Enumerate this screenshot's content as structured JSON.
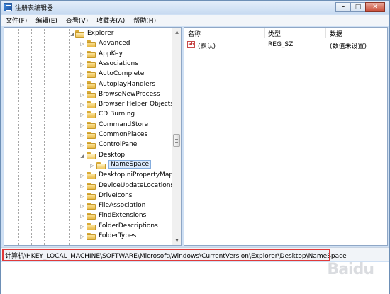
{
  "window": {
    "title": "注册表编辑器",
    "caption_minimize": "–",
    "caption_maximize": "□",
    "caption_close": "✕"
  },
  "menu": [
    "文件(F)",
    "编辑(E)",
    "查看(V)",
    "收藏夹(A)",
    "帮助(H)"
  ],
  "tree": [
    {
      "label": "Explorer",
      "expander": "◢",
      "open": true
    },
    {
      "label": "Advanced",
      "expander": "▷"
    },
    {
      "label": "AppKey",
      "expander": "▷"
    },
    {
      "label": "Associations",
      "expander": "▷"
    },
    {
      "label": "AutoComplete",
      "expander": "▷"
    },
    {
      "label": "AutoplayHandlers",
      "expander": "▷"
    },
    {
      "label": "BrowseNewProcess",
      "expander": "▷"
    },
    {
      "label": "Browser Helper Objects",
      "expander": "▷"
    },
    {
      "label": "CD Burning",
      "expander": "▷"
    },
    {
      "label": "CommandStore",
      "expander": "▷"
    },
    {
      "label": "CommonPlaces",
      "expander": "▷"
    },
    {
      "label": "ControlPanel",
      "expander": "▷"
    },
    {
      "label": "Desktop",
      "expander": "◢",
      "open": true
    },
    {
      "label": "NameSpace",
      "expander": "▷",
      "selected": true
    },
    {
      "label": "DesktopIniPropertyMap",
      "expander": "▷"
    },
    {
      "label": "DeviceUpdateLocations",
      "expander": "▷"
    },
    {
      "label": "DriveIcons",
      "expander": "▷"
    },
    {
      "label": "FileAssociation",
      "expander": "▷"
    },
    {
      "label": "FindExtensions",
      "expander": "▷"
    },
    {
      "label": "FolderDescriptions",
      "expander": "▷"
    },
    {
      "label": "FolderTypes",
      "expander": "▷"
    }
  ],
  "scrollbar": {
    "up": "▲",
    "down": "▼"
  },
  "list": {
    "columns": [
      "名称",
      "类型",
      "数据"
    ],
    "rows": [
      {
        "icon": "ab",
        "name": "(默认)",
        "type": "REG_SZ",
        "data": "(数值未设置)"
      }
    ]
  },
  "status": {
    "path": "计算机\\HKEY_LOCAL_MACHINE\\SOFTWARE\\Microsoft\\Windows\\CurrentVersion\\Explorer\\Desktop\\NameSpace"
  },
  "watermark": "Baidu",
  "colors": {
    "highlight_border": "#e03a3a",
    "selection": "#dbe9fb",
    "folder": "#e8b845"
  },
  "icons": [
    "regedit-app-icon",
    "folder-icon",
    "string-value-icon",
    "tree-expand-arrow-icon"
  ]
}
